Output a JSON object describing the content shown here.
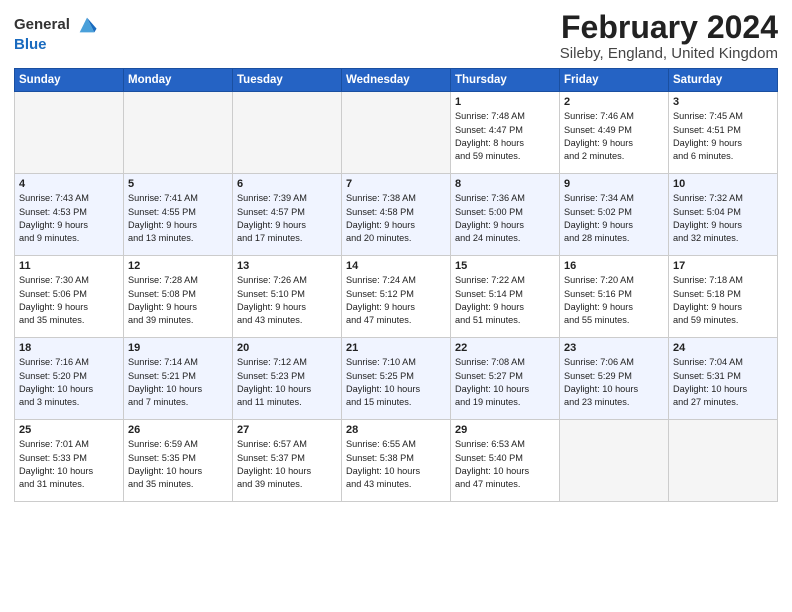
{
  "logo": {
    "general": "General",
    "blue": "Blue"
  },
  "title": "February 2024",
  "subtitle": "Sileby, England, United Kingdom",
  "days_of_week": [
    "Sunday",
    "Monday",
    "Tuesday",
    "Wednesday",
    "Thursday",
    "Friday",
    "Saturday"
  ],
  "weeks": [
    [
      {
        "num": "",
        "info": "",
        "empty": true
      },
      {
        "num": "",
        "info": "",
        "empty": true
      },
      {
        "num": "",
        "info": "",
        "empty": true
      },
      {
        "num": "",
        "info": "",
        "empty": true
      },
      {
        "num": "1",
        "info": "Sunrise: 7:48 AM\nSunset: 4:47 PM\nDaylight: 8 hours\nand 59 minutes."
      },
      {
        "num": "2",
        "info": "Sunrise: 7:46 AM\nSunset: 4:49 PM\nDaylight: 9 hours\nand 2 minutes."
      },
      {
        "num": "3",
        "info": "Sunrise: 7:45 AM\nSunset: 4:51 PM\nDaylight: 9 hours\nand 6 minutes."
      }
    ],
    [
      {
        "num": "4",
        "info": "Sunrise: 7:43 AM\nSunset: 4:53 PM\nDaylight: 9 hours\nand 9 minutes."
      },
      {
        "num": "5",
        "info": "Sunrise: 7:41 AM\nSunset: 4:55 PM\nDaylight: 9 hours\nand 13 minutes."
      },
      {
        "num": "6",
        "info": "Sunrise: 7:39 AM\nSunset: 4:57 PM\nDaylight: 9 hours\nand 17 minutes."
      },
      {
        "num": "7",
        "info": "Sunrise: 7:38 AM\nSunset: 4:58 PM\nDaylight: 9 hours\nand 20 minutes."
      },
      {
        "num": "8",
        "info": "Sunrise: 7:36 AM\nSunset: 5:00 PM\nDaylight: 9 hours\nand 24 minutes."
      },
      {
        "num": "9",
        "info": "Sunrise: 7:34 AM\nSunset: 5:02 PM\nDaylight: 9 hours\nand 28 minutes."
      },
      {
        "num": "10",
        "info": "Sunrise: 7:32 AM\nSunset: 5:04 PM\nDaylight: 9 hours\nand 32 minutes."
      }
    ],
    [
      {
        "num": "11",
        "info": "Sunrise: 7:30 AM\nSunset: 5:06 PM\nDaylight: 9 hours\nand 35 minutes."
      },
      {
        "num": "12",
        "info": "Sunrise: 7:28 AM\nSunset: 5:08 PM\nDaylight: 9 hours\nand 39 minutes."
      },
      {
        "num": "13",
        "info": "Sunrise: 7:26 AM\nSunset: 5:10 PM\nDaylight: 9 hours\nand 43 minutes."
      },
      {
        "num": "14",
        "info": "Sunrise: 7:24 AM\nSunset: 5:12 PM\nDaylight: 9 hours\nand 47 minutes."
      },
      {
        "num": "15",
        "info": "Sunrise: 7:22 AM\nSunset: 5:14 PM\nDaylight: 9 hours\nand 51 minutes."
      },
      {
        "num": "16",
        "info": "Sunrise: 7:20 AM\nSunset: 5:16 PM\nDaylight: 9 hours\nand 55 minutes."
      },
      {
        "num": "17",
        "info": "Sunrise: 7:18 AM\nSunset: 5:18 PM\nDaylight: 9 hours\nand 59 minutes."
      }
    ],
    [
      {
        "num": "18",
        "info": "Sunrise: 7:16 AM\nSunset: 5:20 PM\nDaylight: 10 hours\nand 3 minutes."
      },
      {
        "num": "19",
        "info": "Sunrise: 7:14 AM\nSunset: 5:21 PM\nDaylight: 10 hours\nand 7 minutes."
      },
      {
        "num": "20",
        "info": "Sunrise: 7:12 AM\nSunset: 5:23 PM\nDaylight: 10 hours\nand 11 minutes."
      },
      {
        "num": "21",
        "info": "Sunrise: 7:10 AM\nSunset: 5:25 PM\nDaylight: 10 hours\nand 15 minutes."
      },
      {
        "num": "22",
        "info": "Sunrise: 7:08 AM\nSunset: 5:27 PM\nDaylight: 10 hours\nand 19 minutes."
      },
      {
        "num": "23",
        "info": "Sunrise: 7:06 AM\nSunset: 5:29 PM\nDaylight: 10 hours\nand 23 minutes."
      },
      {
        "num": "24",
        "info": "Sunrise: 7:04 AM\nSunset: 5:31 PM\nDaylight: 10 hours\nand 27 minutes."
      }
    ],
    [
      {
        "num": "25",
        "info": "Sunrise: 7:01 AM\nSunset: 5:33 PM\nDaylight: 10 hours\nand 31 minutes."
      },
      {
        "num": "26",
        "info": "Sunrise: 6:59 AM\nSunset: 5:35 PM\nDaylight: 10 hours\nand 35 minutes."
      },
      {
        "num": "27",
        "info": "Sunrise: 6:57 AM\nSunset: 5:37 PM\nDaylight: 10 hours\nand 39 minutes."
      },
      {
        "num": "28",
        "info": "Sunrise: 6:55 AM\nSunset: 5:38 PM\nDaylight: 10 hours\nand 43 minutes."
      },
      {
        "num": "29",
        "info": "Sunrise: 6:53 AM\nSunset: 5:40 PM\nDaylight: 10 hours\nand 47 minutes."
      },
      {
        "num": "",
        "info": "",
        "empty": true
      },
      {
        "num": "",
        "info": "",
        "empty": true
      }
    ]
  ]
}
